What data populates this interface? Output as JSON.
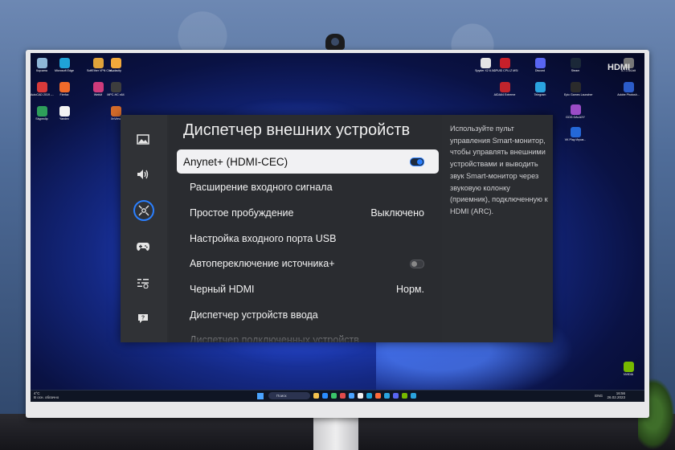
{
  "desktop": {
    "hdmi_label": "HDMI",
    "icons_left": [
      {
        "label": "Корзина",
        "color": "#8fb7d8"
      },
      {
        "label": "Microsoft Edge",
        "color": "#1fa3d8"
      },
      {
        "label": "SoftEther VPN Clie...",
        "color": "#e0a33a"
      },
      {
        "label": "Audacity",
        "color": "#f2a93b"
      },
      {
        "label": "AutoCAD 2019 -...",
        "color": "#d93a3a"
      },
      {
        "label": "Firefox",
        "color": "#f06a2a"
      },
      {
        "label": "WebM",
        "color": "#cf3b7b"
      },
      {
        "label": "MPC-HC x64",
        "color": "#3d3d3d"
      },
      {
        "label": "Skypeclip",
        "color": "#2e9e5a"
      },
      {
        "label": "Yandex",
        "color": "#f4f4f4"
      },
      {
        "label": "XnView",
        "color": "#d46b2a"
      }
    ],
    "icons_right": [
      {
        "label": "Spyder X2 6.0.1",
        "color": "#e4e4e4"
      },
      {
        "label": "CPUID CPU-Z MSI",
        "color": "#c8202a"
      },
      {
        "label": "Discord",
        "color": "#5865f2"
      },
      {
        "label": "Steam",
        "color": "#1b2838"
      },
      {
        "label": "AIDA64 Extreme",
        "color": "#c0242c"
      },
      {
        "label": "Telegram",
        "color": "#2aa3df"
      },
      {
        "label": "Epic Games Launcher",
        "color": "#2b2b2b"
      },
      {
        "label": "Adobe Photosh...",
        "color": "#2b5cc9"
      },
      {
        "label": "GOG GALAXY",
        "color": "#9b4cc7"
      },
      {
        "label": "VK Play Игров...",
        "color": "#2468d8"
      },
      {
        "label": "5.7.1 64-bit",
        "color": "#777777"
      },
      {
        "label": "NVIDIA",
        "color": "#76b900"
      }
    ]
  },
  "taskbar": {
    "weather_temp": "4°C",
    "weather_desc": "В осн. облачно",
    "search_placeholder": "Поиск",
    "lang": "ENG",
    "time": "16:56",
    "date": "26.02.2023",
    "app_colors": [
      "#f2c14e",
      "#2a8cff",
      "#3ac46a",
      "#e04b4b",
      "#4aa3ff",
      "#f2f2f2",
      "#1fa3d8",
      "#ff6b3a",
      "#2aa3df",
      "#5865f2",
      "#76b900",
      "#2aa3df"
    ]
  },
  "osd": {
    "title": "Диспетчер внешних устройств",
    "sidebar": [
      {
        "name": "picture",
        "icon": "picture-icon",
        "active": false
      },
      {
        "name": "sound",
        "icon": "speaker-icon",
        "active": false
      },
      {
        "name": "connection",
        "icon": "connection-icon",
        "active": true
      },
      {
        "name": "game",
        "icon": "gamepad-icon",
        "active": false
      },
      {
        "name": "general",
        "icon": "general-settings-icon",
        "active": false
      },
      {
        "name": "support",
        "icon": "support-icon",
        "active": false
      }
    ],
    "items": [
      {
        "label": "Anynet+ (HDMI-CEC)",
        "value": "",
        "toggle": "on",
        "selected": true
      },
      {
        "label": "Расширение входного сигнала",
        "value": "",
        "toggle": "",
        "selected": false
      },
      {
        "label": "Простое пробуждение",
        "value": "Выключено",
        "toggle": "",
        "selected": false
      },
      {
        "label": "Настройка входного порта USB",
        "value": "",
        "toggle": "",
        "selected": false
      },
      {
        "label": "Автопереключение источника+",
        "value": "",
        "toggle": "off",
        "selected": false
      },
      {
        "label": "Черный HDMI",
        "value": "Норм.",
        "toggle": "",
        "selected": false
      },
      {
        "label": "Диспетчер устройств ввода",
        "value": "",
        "toggle": "",
        "selected": false
      },
      {
        "label": "Диспетчер подключенных устройств",
        "value": "",
        "toggle": "",
        "selected": false
      }
    ],
    "help_text": "Используйте пульт управления Smart-монитор, чтобы управлять внешними устройствами и выводить звук Smart-монитор через звуковую колонку (приемник), подключенную к HDMI (ARC).",
    "accent_color": "#2a7fff"
  }
}
